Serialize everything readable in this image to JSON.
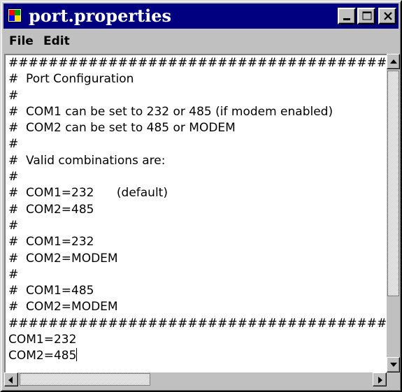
{
  "window": {
    "title": "port.properties",
    "icon": "java-app-icon",
    "controls": [
      "minimize-icon",
      "maximize-icon",
      "close-icon"
    ]
  },
  "menu": {
    "file": "File",
    "edit": "Edit"
  },
  "editor": {
    "lines": [
      "####################################################",
      "#  Port Configuration",
      "#",
      "#  COM1 can be set to 232 or 485 (if modem enabled)",
      "#  COM2 can be set to 485 or MODEM",
      "#",
      "#  Valid combinations are:",
      "#",
      "#  COM1=232      (default)",
      "#  COM2=485",
      "#",
      "#  COM1=232",
      "#  COM2=MODEM",
      "#",
      "#  COM1=485",
      "#  COM2=MODEM",
      "####################################################",
      "COM1=232",
      "COM2=485"
    ]
  },
  "scrollbars": {
    "vertical": {
      "up": "arrow-up-icon",
      "down": "arrow-down-icon"
    },
    "horizontal": {
      "left": "arrow-left-icon",
      "right": "arrow-right-icon"
    }
  },
  "colors": {
    "titlebar": "#000080",
    "chrome": "#c0c0c0",
    "editor_bg": "#ffffff"
  }
}
